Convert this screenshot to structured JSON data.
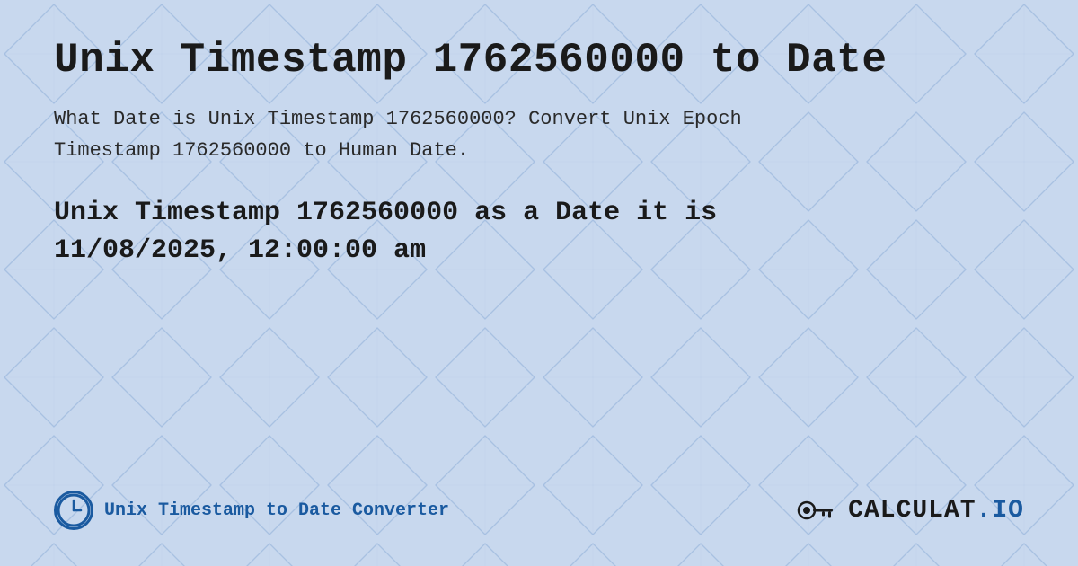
{
  "page": {
    "title": "Unix Timestamp 1762560000 to Date",
    "description_part1": "What Date is Unix Timestamp 1762560000? Convert Unix Epoch",
    "description_part2": "Timestamp 1762560000 to Human Date.",
    "result_line1": "Unix Timestamp 1762560000 as a Date it is",
    "result_line2": "11/08/2025, 12:00:00 am",
    "footer_label": "Unix Timestamp to Date Converter",
    "brand_name": "CALCULAT.IO"
  },
  "colors": {
    "accent": "#1a5aa0",
    "text_dark": "#1a1a1a",
    "bg": "#c8d8f0"
  }
}
